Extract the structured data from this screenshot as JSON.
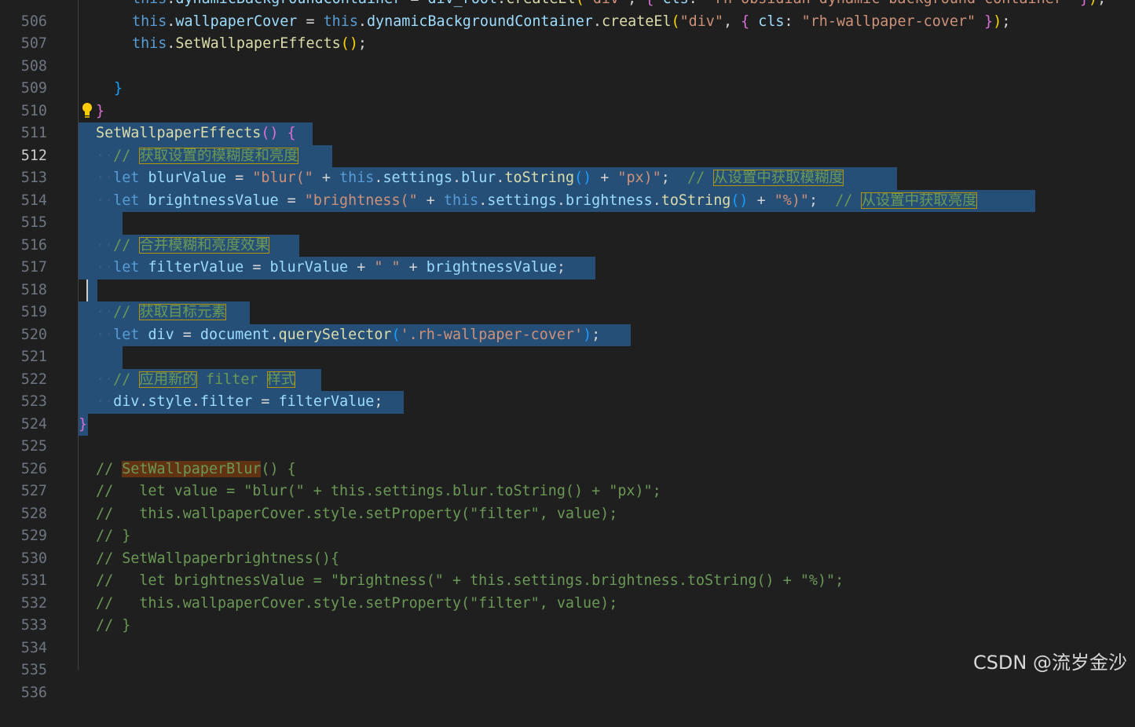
{
  "editor": {
    "first_line": 506,
    "active_line": 512,
    "lines": [
      {
        "n": "506",
        "t": "        this.dynamicBackgroundContainer = div_root.createEl(\"div\", { cls: \"rh-obsidian-dynamic-background-container\" });"
      },
      {
        "n": "507",
        "t": "        this.wallpaperCover = this.dynamicBackgroundContainer.createEl(\"div\", { cls: \"rh-wallpaper-cover\" });"
      },
      {
        "n": "508",
        "t": "        this.SetWallpaperEffects();"
      },
      {
        "n": "509",
        "t": ""
      },
      {
        "n": "510",
        "t": "    }"
      },
      {
        "n": "511",
        "t": " }"
      },
      {
        "n": "512",
        "t": " SetWallpaperEffects() {"
      },
      {
        "n": "513",
        "t": "  // 获取设置的模糊度和亮度"
      },
      {
        "n": "514",
        "t": "  let blurValue = \"blur(\" + this.settings.blur.toString() + \"px)\";  // 从设置中获取模糊度"
      },
      {
        "n": "515",
        "t": "  let brightnessValue = \"brightness(\" + this.settings.brightness.toString() + \"%)\";  // 从设置中获取亮度"
      },
      {
        "n": "516",
        "t": ""
      },
      {
        "n": "517",
        "t": "  // 合并模糊和亮度效果"
      },
      {
        "n": "518",
        "t": "  let filterValue = blurValue + \" \" + brightnessValue;"
      },
      {
        "n": "519",
        "t": ""
      },
      {
        "n": "520",
        "t": "  // 获取目标元素"
      },
      {
        "n": "521",
        "t": "  let div = document.querySelector('.rh-wallpaper-cover');"
      },
      {
        "n": "522",
        "t": ""
      },
      {
        "n": "523",
        "t": "  // 应用新的 filter 样式"
      },
      {
        "n": "524",
        "t": "  div.style.filter = filterValue;"
      },
      {
        "n": "525",
        "t": "}"
      },
      {
        "n": "526",
        "t": ""
      },
      {
        "n": "527",
        "t": " // SetWallpaperBlur() {"
      },
      {
        "n": "528",
        "t": " //   let value = \"blur(\" + this.settings.blur.toString() + \"px)\";"
      },
      {
        "n": "529",
        "t": " //   this.wallpaperCover.style.setProperty(\"filter\", value);"
      },
      {
        "n": "530",
        "t": " // }"
      },
      {
        "n": "531",
        "t": " // SetWallpaperbrightness(){"
      },
      {
        "n": "532",
        "t": " //   let brightnessValue = \"brightness(\" + this.settings.brightness.toString() + \"%)\";"
      },
      {
        "n": "533",
        "t": " //   this.wallpaperCover.style.setProperty(\"filter\", value);"
      },
      {
        "n": "534",
        "t": " // }"
      },
      {
        "n": "535",
        "t": ""
      },
      {
        "n": "536",
        "t": ""
      }
    ]
  },
  "watermark": "CSDN @流岁金沙",
  "icons": {
    "lightbulb": "lightbulb-icon"
  },
  "colors": {
    "background": "#1f1f1f",
    "selection": "#264f78",
    "comment": "#6a9955",
    "keyword": "#569cd6"
  }
}
